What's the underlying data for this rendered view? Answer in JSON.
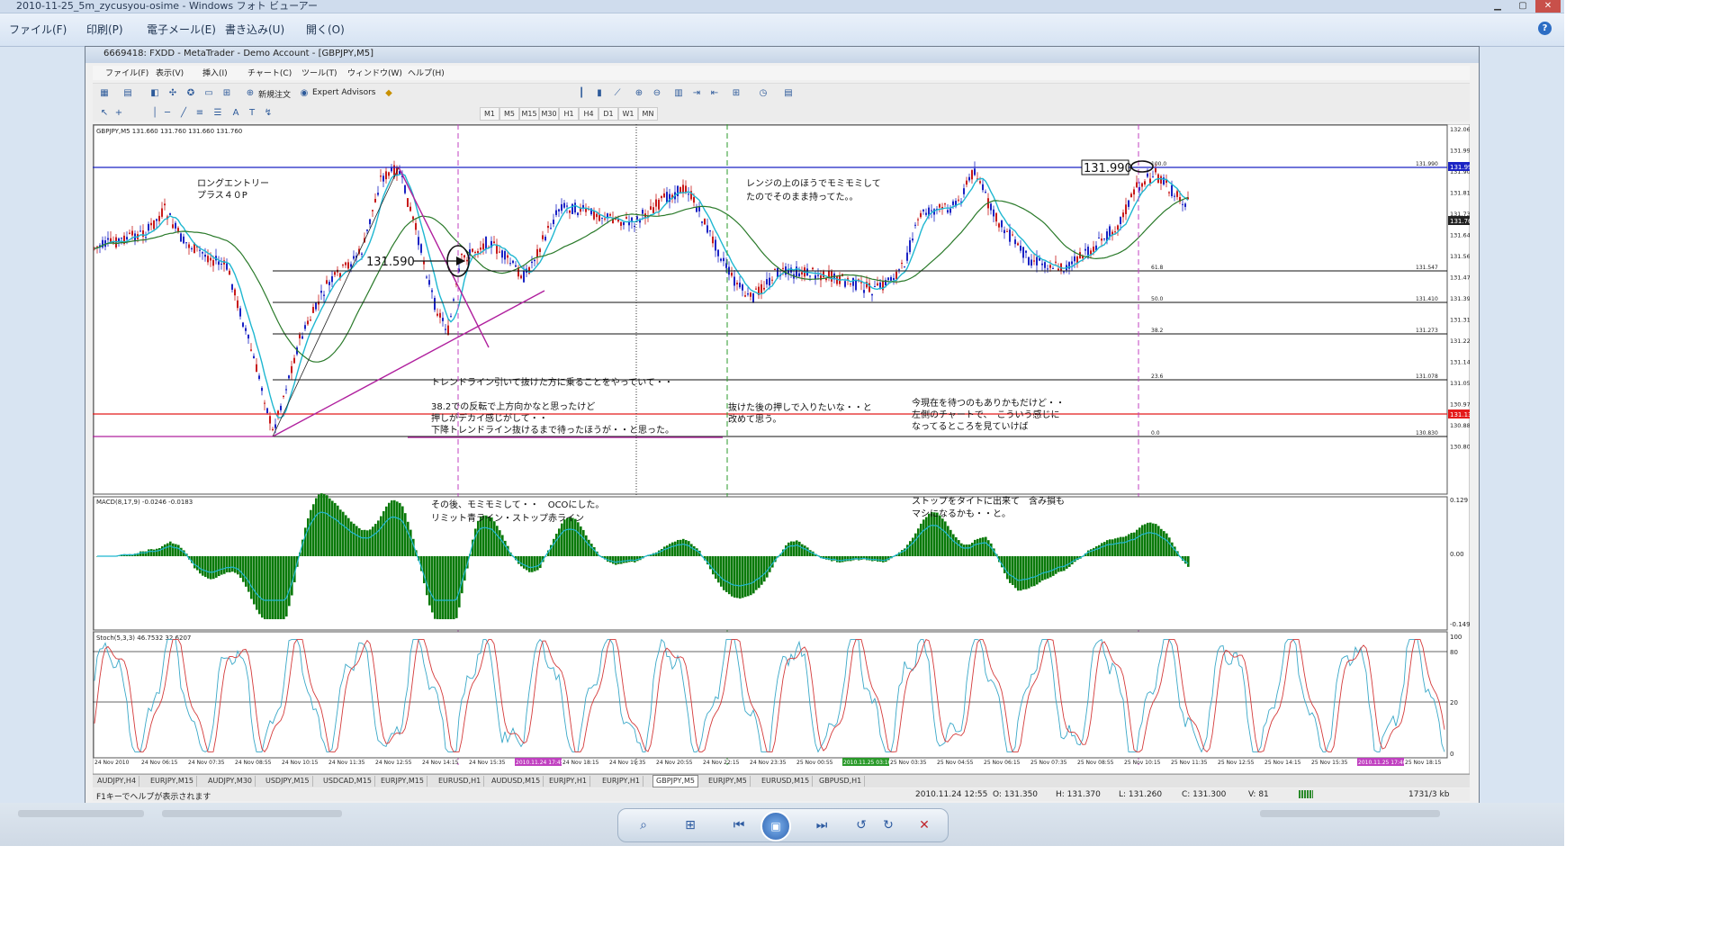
{
  "viewer": {
    "title": "2010-11-25_5m_zycusyou-osime - Windows フォト ビューアー",
    "menu": [
      "ファイル(F)",
      "印刷(P)",
      "電子メール(E)",
      "書き込み(U)",
      "開く(O)"
    ],
    "help_icon": "?"
  },
  "mt4": {
    "title": "6669418: FXDD - MetaTrader - Demo Account - [GBPJPY,M5]",
    "menu": [
      "ファイル(F)",
      "表示(V)",
      "挿入(I)",
      "チャート(C)",
      "ツール(T)",
      "ウィンドウ(W)",
      "ヘルプ(H)"
    ],
    "toolbar": {
      "new_order": "新規注文",
      "expert_advisors": "Expert Advisors"
    },
    "timeframes": [
      "M1",
      "M5",
      "M15",
      "M30",
      "H1",
      "H4",
      "D1",
      "W1",
      "MN"
    ],
    "tabs": [
      "AUDJPY,H4",
      "EURJPY,M15",
      "AUDJPY,M30",
      "USDJPY,M15",
      "USDCAD,M15",
      "EURJPY,M15",
      "EURUSD,H1",
      "AUDUSD,M15",
      "EURJPY,H1",
      "EURJPY,H1",
      "GBPJPY,M5",
      "EURJPY,M5",
      "EURUSD,M15",
      "GBPUSD,H1"
    ],
    "active_tab": "GBPJPY,M5",
    "status": {
      "help": "F1キーでヘルプが表示されます",
      "datetime": "2010.11.24 12:55",
      "open": "O: 131.350",
      "high": "H: 131.370",
      "low": "L: 131.260",
      "close": "C: 131.300",
      "volume": "V: 81",
      "traffic": "1731/3 kb"
    }
  },
  "chart": {
    "header": "GBPJPY,M5  131.660 131.760 131.660 131.760",
    "price_labels": [
      "132.065",
      "131.990",
      "131.900",
      "131.815",
      "131.730",
      "131.645",
      "131.560",
      "131.475",
      "131.390",
      "131.310",
      "131.225",
      "131.140",
      "131.055",
      "130.970",
      "130.885",
      "130.806"
    ],
    "current_price": "131.760",
    "tp_price": "131.990",
    "sl_price": "131.138",
    "fib_labels": [
      {
        "level": "100.0",
        "value": "131.990"
      },
      {
        "level": "61.8",
        "value": "131.547"
      },
      {
        "level": "50.0",
        "value": "131.410"
      },
      {
        "level": "38.2",
        "value": "131.273"
      },
      {
        "level": "23.6",
        "value": "131.078"
      },
      {
        "level": "0.0",
        "value": "130.830"
      }
    ],
    "callouts": {
      "entry": "131.590",
      "target": "131.990"
    },
    "annotations": {
      "a1": "ロングエントリー",
      "a2": "プラス４０P",
      "a3": "レンジの上のほうでモミモミして",
      "a4": "たのでそのまま持ってた。。",
      "a5": "トレンドライン引いて抜けた方に乗ることをやっていて・・",
      "a6": "38.2での反転で上方向かなと思ったけど",
      "a7": "押しがデカイ感じがして・・",
      "a8": "下降トレンドライン抜けるまで待ったほうが・・と思った。",
      "a9": "抜けた後の押しで入りたいな・・と",
      "a10": "改めて思う。",
      "a11": "今現在を待つのもありかもだけど・・",
      "a12": "左側のチャートで、　こういう感じに",
      "a13": "なってるところを見ていけば",
      "a14": "その後、モミモミして・・　OCOにした。",
      "a15": "リミット青ライン・ストップ赤ライン",
      "a16": "ストップをタイトに出来て　含み損も",
      "a17": "マシになるかも・・と。"
    },
    "macd": {
      "header": "MACD(8,17,9) -0.0246 -0.0183",
      "top": "0.129",
      "zero": "0.00",
      "bottom": "-0.1494"
    },
    "stoch": {
      "header": "Stoch(5,3,3) 46.7532 32.6207",
      "top": "100",
      "upper": "80",
      "lower": "20",
      "bottom": "0"
    },
    "time_labels": [
      "24 Nov 2010",
      "24 Nov 06:15",
      "24 Nov 07:35",
      "24 Nov 08:55",
      "24 Nov 10:15",
      "24 Nov 11:35",
      "24 Nov 12:55",
      "24 Nov 14:15",
      "24 Nov 15:35",
      "2010.11.24 17:45",
      "24 Nov 18:15",
      "24 Nov 19:35",
      "24 Nov 20:55",
      "24 Nov 22:15",
      "24 Nov 23:35",
      "25 Nov 00:55",
      "2010.11.25 03:10",
      "25 Nov 03:35",
      "25 Nov 04:55",
      "25 Nov 06:15",
      "25 Nov 07:35",
      "25 Nov 08:55",
      "25 Nov 10:15",
      "25 Nov 11:35",
      "25 Nov 12:55",
      "25 Nov 14:15",
      "25 Nov 15:35",
      "2010.11.25 17:40",
      "25 Nov 18:15"
    ]
  },
  "photo_viewer": {
    "zoom": "⌕",
    "fit": "⊞",
    "prev": "⏮",
    "slideshow": "▣",
    "next": "⏭",
    "rotl": "↺",
    "rotr": "↻",
    "delete": "✕"
  },
  "colors": {
    "blue_line": "#1a23c4",
    "red_line": "#e41b1b",
    "trend": "#b0209e",
    "macd_hist": "#0a7a0a",
    "cyan": "#1fb7d1"
  }
}
